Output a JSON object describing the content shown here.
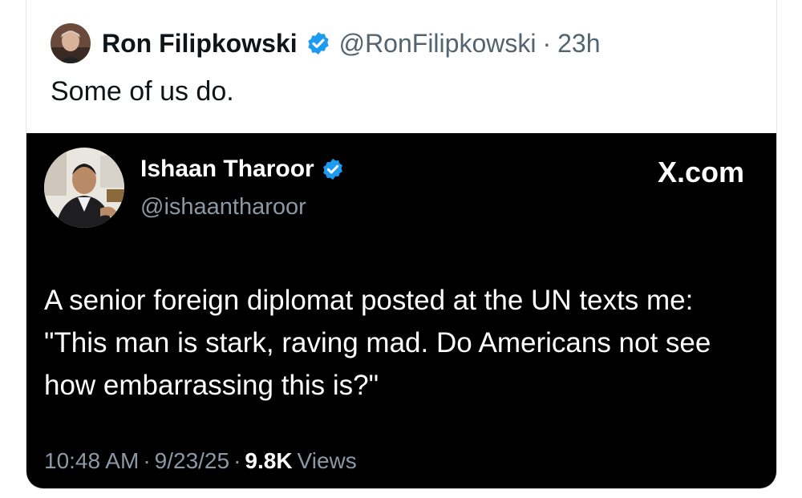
{
  "outer_tweet": {
    "author_name": "Ron Filipkowski",
    "handle": "@RonFilipkowski",
    "separator": "·",
    "time": "23h",
    "text": "Some of us do.",
    "verified_color": "#1d9bf0"
  },
  "quoted_tweet": {
    "author_name": "Ishaan Tharoor",
    "handle": "@ishaantharoor",
    "brand": "X.com",
    "text": "A senior foreign diplomat posted at the UN texts me: \"This man is stark, raving mad. Do Americans not see how embarrassing this is?\"",
    "meta": {
      "time": "10:48 AM",
      "sep1": "·",
      "date": "9/23/25",
      "sep2": "·",
      "views_count": "9.8K",
      "views_label": "Views"
    },
    "background": "#000000"
  },
  "icons": {
    "verified": "verified-badge-icon"
  }
}
